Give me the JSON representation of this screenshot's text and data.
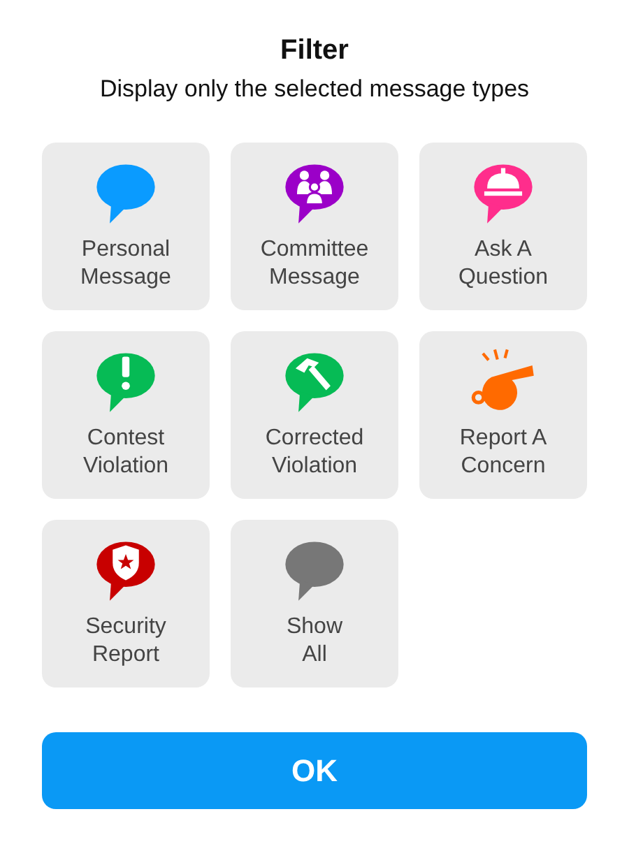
{
  "title": "Filter",
  "subtitle": "Display only the selected message types",
  "options": [
    {
      "kind": "bubble",
      "color": "#0a9bff",
      "label": [
        "Personal",
        "Message"
      ]
    },
    {
      "kind": "people",
      "color": "#9b00c8",
      "label": [
        "Committee",
        "Message"
      ]
    },
    {
      "kind": "bell",
      "color": "#ff2d8c",
      "label": [
        "Ask A",
        "Question"
      ]
    },
    {
      "kind": "exclaim",
      "color": "#06bb55",
      "label": [
        "Contest",
        "Violation"
      ]
    },
    {
      "kind": "hammer",
      "color": "#06bb55",
      "label": [
        "Corrected",
        "Violation"
      ]
    },
    {
      "kind": "whistle",
      "color": "#ff6a00",
      "label": [
        "Report A",
        "Concern"
      ]
    },
    {
      "kind": "shield",
      "color": "#c80000",
      "label": [
        "Security",
        "Report"
      ]
    },
    {
      "kind": "bubble",
      "color": "#777777",
      "label": [
        "Show",
        "All"
      ]
    }
  ],
  "ok_button": "OK"
}
